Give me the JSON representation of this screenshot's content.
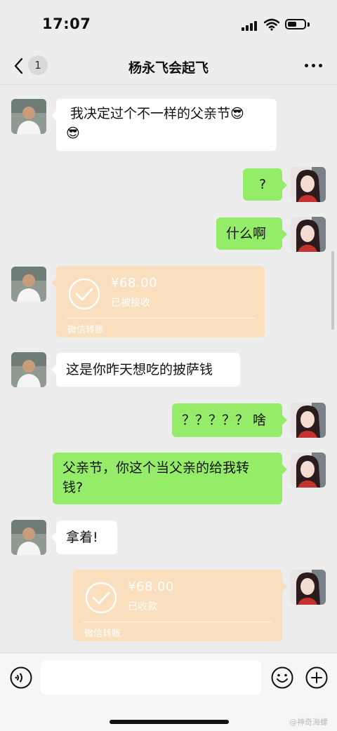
{
  "status_bar": {
    "time": "17:07",
    "battery_level": 0.55
  },
  "nav": {
    "unread_count": "1",
    "title": "杨永飞会起飞"
  },
  "messages": [
    {
      "sender": "other",
      "type": "text",
      "line1": "我决定过个不一样的父亲节😎",
      "line2": "😎"
    },
    {
      "sender": "me",
      "type": "text",
      "text": "?"
    },
    {
      "sender": "me",
      "type": "text",
      "text": "什么啊"
    },
    {
      "sender": "other",
      "type": "transfer",
      "amount": "¥68.00",
      "status": "已被接收",
      "label": "微信转账"
    },
    {
      "sender": "other",
      "type": "text",
      "text": "这是你昨天想吃的披萨钱"
    },
    {
      "sender": "me",
      "type": "text",
      "text": "？？？？？ 啥"
    },
    {
      "sender": "me",
      "type": "text",
      "line1": "父亲节，你这个当父亲的给我转",
      "line2": "钱?"
    },
    {
      "sender": "other",
      "type": "text",
      "text": "拿着!"
    },
    {
      "sender": "me",
      "type": "transfer",
      "amount": "¥68.00",
      "status": "已收款",
      "label": "微信转账"
    }
  ],
  "input_bar": {
    "voice_icon": "voice-icon",
    "emoji_icon": "emoji-icon",
    "add_icon": "plus-icon"
  },
  "watermark": "@神奇海螺",
  "colors": {
    "background": "#ededed",
    "my_bubble": "#95ec69",
    "other_bubble": "#ffffff",
    "transfer": "#f9dfbd"
  }
}
